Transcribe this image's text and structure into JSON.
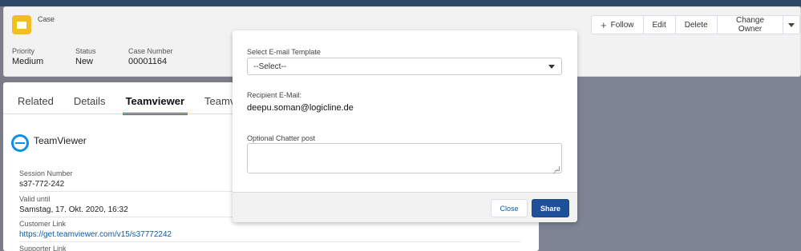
{
  "record": {
    "object_label": "Case",
    "actions": {
      "follow": "Follow",
      "edit": "Edit",
      "delete": "Delete",
      "change_owner": "Change Owner"
    },
    "highlights": [
      {
        "label": "Priority",
        "value": "Medium"
      },
      {
        "label": "Status",
        "value": "New"
      },
      {
        "label": "Case Number",
        "value": "00001164"
      }
    ]
  },
  "tabs": [
    {
      "label": "Related"
    },
    {
      "label": "Details"
    },
    {
      "label": "Teamviewer"
    },
    {
      "label": "Teamvi"
    }
  ],
  "teamviewer": {
    "title": "TeamViewer",
    "fields": [
      {
        "label": "Session Number",
        "value": "s37-772-242"
      },
      {
        "label": "Valid until",
        "value": "Samstag, 17. Okt. 2020, 16:32"
      },
      {
        "label": "Customer Link",
        "value": "https://get.teamviewer.com/v15/s37772242"
      },
      {
        "label": "Supporter Link",
        "value": ""
      }
    ]
  },
  "modal": {
    "template_label": "Select E-mail Template",
    "template_value": "--Select--",
    "recipient_label": "Recipient E-Mail:",
    "recipient_value": "deepu.soman@logicline.de",
    "chatter_label": "Optional Chatter post",
    "chatter_value": "",
    "close_label": "Close",
    "share_label": "Share"
  },
  "colors": {
    "brand": "#0b5cab",
    "share_button": "#1e4f99",
    "case_icon": "#f4bc25",
    "teamviewer": "#0e8ee9"
  },
  "icons": {
    "follow": "plus-icon",
    "overflow": "chevron-down-icon",
    "record": "case-icon",
    "teamviewer": "teamviewer-logo-icon"
  }
}
